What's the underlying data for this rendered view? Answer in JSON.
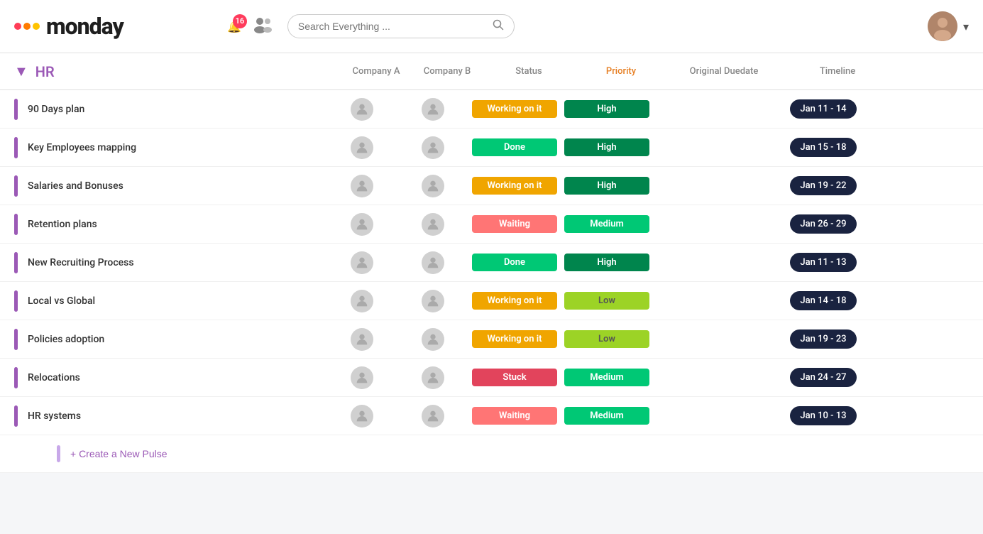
{
  "header": {
    "logo": "monday",
    "notification_count": "16",
    "search_placeholder": "Search Everything ...",
    "search_label": "Search Everything"
  },
  "board": {
    "title": "HR",
    "columns": {
      "company_a": "Company A",
      "company_b": "Company B",
      "status": "Status",
      "priority": "Priority",
      "duedate": "Original Duedate",
      "timeline": "Timeline"
    },
    "rows": [
      {
        "name": "90 Days plan",
        "status": "Working on it",
        "status_class": "status-working",
        "priority": "High",
        "priority_class": "priority-high",
        "timeline": "Jan 11 - 14"
      },
      {
        "name": "Key Employees mapping",
        "status": "Done",
        "status_class": "status-done",
        "priority": "High",
        "priority_class": "priority-high",
        "timeline": "Jan 15 - 18"
      },
      {
        "name": "Salaries and Bonuses",
        "status": "Working on it",
        "status_class": "status-working",
        "priority": "High",
        "priority_class": "priority-high",
        "timeline": "Jan 19 - 22"
      },
      {
        "name": "Retention plans",
        "status": "Waiting",
        "status_class": "status-waiting",
        "priority": "Medium",
        "priority_class": "priority-medium",
        "timeline": "Jan 26 - 29"
      },
      {
        "name": "New Recruiting Process",
        "status": "Done",
        "status_class": "status-done",
        "priority": "High",
        "priority_class": "priority-high",
        "timeline": "Jan 11 - 13"
      },
      {
        "name": "Local vs Global",
        "status": "Working on it",
        "status_class": "status-working",
        "priority": "Low",
        "priority_class": "priority-low",
        "timeline": "Jan 14 - 18"
      },
      {
        "name": "Policies adoption",
        "status": "Working on it",
        "status_class": "status-working",
        "priority": "Low",
        "priority_class": "priority-low",
        "timeline": "Jan 19 - 23"
      },
      {
        "name": "Relocations",
        "status": "Stuck",
        "status_class": "status-stuck",
        "priority": "Medium",
        "priority_class": "priority-medium",
        "timeline": "Jan 24 - 27"
      },
      {
        "name": "HR systems",
        "status": "Waiting",
        "status_class": "status-waiting",
        "priority": "Medium",
        "priority_class": "priority-medium",
        "timeline": "Jan 10 - 13"
      }
    ],
    "create_pulse": "+ Create a New Pulse"
  }
}
